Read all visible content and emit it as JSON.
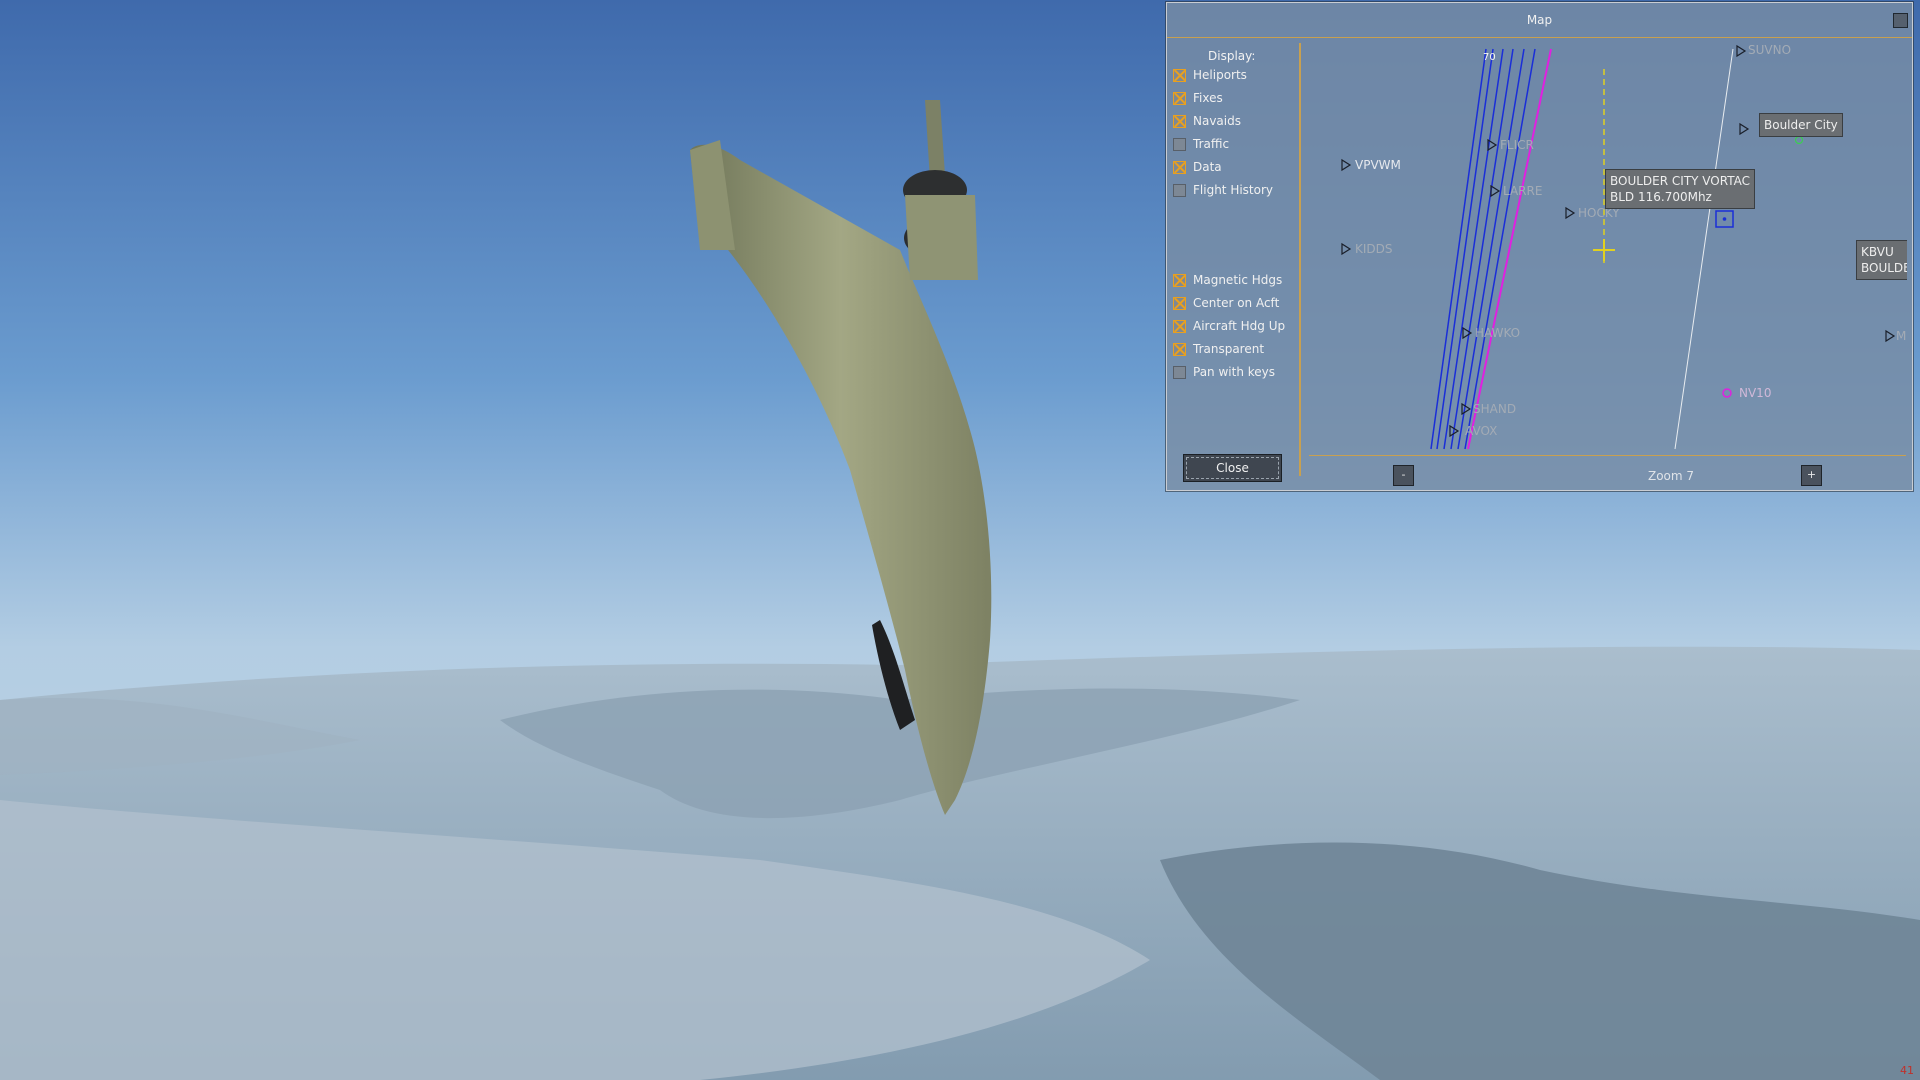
{
  "map": {
    "title": "Map",
    "display_label": "Display:",
    "options": [
      {
        "label": "Heliports",
        "checked": true
      },
      {
        "label": "Fixes",
        "checked": true
      },
      {
        "label": "Navaids",
        "checked": true
      },
      {
        "label": "Traffic",
        "checked": false
      },
      {
        "label": "Data",
        "checked": true
      },
      {
        "label": "Flight History",
        "checked": false
      }
    ],
    "view_options": [
      {
        "label": "Magnetic Hdgs",
        "checked": true
      },
      {
        "label": "Center on Acft",
        "checked": true
      },
      {
        "label": "Aircraft Hdg Up",
        "checked": true
      },
      {
        "label": "Transparent",
        "checked": true
      },
      {
        "label": "Pan with keys",
        "checked": false
      }
    ],
    "close_label": "Close",
    "zoom_minus": "-",
    "zoom_plus": "+",
    "zoom_label": "Zoom 7",
    "heading_tick": "70",
    "fixes": [
      "VPVWM",
      "FLICR",
      "LARRE",
      "HOCKY",
      "KIDDS",
      "HAWKO",
      "SHAND",
      "AVOX",
      "SUVNO",
      "MINEY"
    ],
    "nv_label": "NV10",
    "boulder_city": "Boulder City",
    "vortac": {
      "name": "BOULDER CITY VORTAC",
      "freq": "BLD 116.700Mhz"
    },
    "kbvu": {
      "code": "KBVU",
      "name": "BOULDE"
    }
  },
  "hud": {
    "fps": "41"
  },
  "colors": {
    "accent": "#c8a050",
    "check": "#e8a020",
    "route_blue": "#1a2ed8",
    "route_magenta": "#e020e0"
  }
}
